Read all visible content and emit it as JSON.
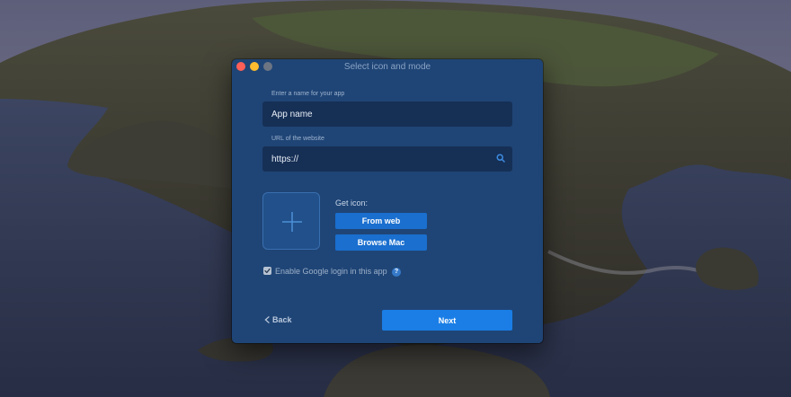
{
  "window": {
    "title": "Select icon and mode"
  },
  "form": {
    "name_label": "Enter a name for your app",
    "name_placeholder": "App name",
    "url_label": "URL of the website",
    "url_value": "https://"
  },
  "icon_section": {
    "get_icon_label": "Get icon:",
    "from_web_label": "From web",
    "browse_mac_label": "Browse Mac"
  },
  "options": {
    "google_login_label": "Enable Google login in this app",
    "google_login_checked": true,
    "help_glyph": "?"
  },
  "footer": {
    "back_label": "Back",
    "next_label": "Next"
  },
  "icons": [
    "search-icon",
    "plus-icon",
    "checkmark-icon",
    "help-icon",
    "chevron-left-icon"
  ],
  "colors": {
    "window_bg": "#1f4576",
    "field_bg": "#162f55",
    "accent_button": "#1a7ee6",
    "small_button": "#1a6fcf",
    "close": "#fe5f57",
    "minimize": "#febc2e"
  }
}
